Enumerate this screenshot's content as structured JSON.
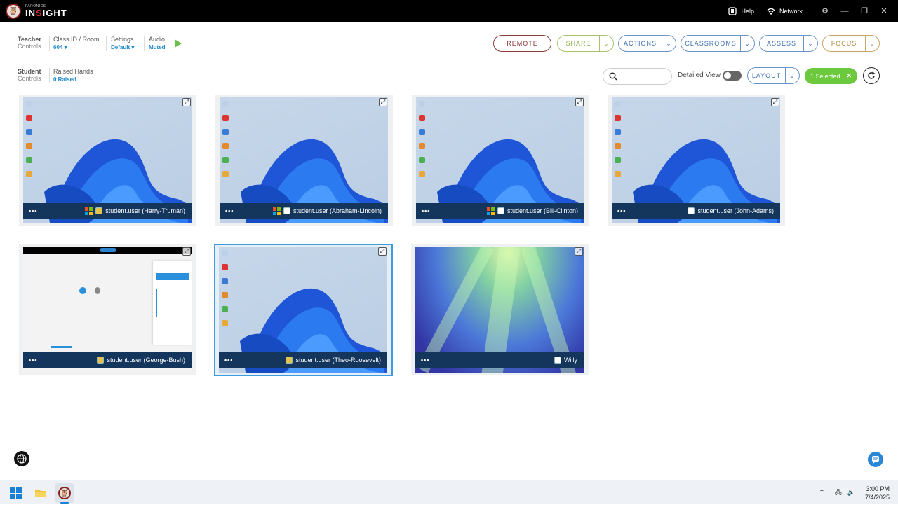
{
  "app": {
    "brand": "FARONICS",
    "name_prefix": "IN",
    "name_red": "S",
    "name_suffix": "IGHT",
    "help": "Help",
    "network": "Network"
  },
  "teacher_controls": {
    "title": "Teacher",
    "subtitle": "Controls",
    "class_label": "Class ID / Room",
    "class_value": "604 ▾",
    "settings_label": "Settings",
    "settings_value": "Default ▾",
    "audio_label": "Audio",
    "audio_value": "Muted"
  },
  "student_controls": {
    "title": "Student",
    "subtitle": "Controls",
    "raised_label": "Raised Hands",
    "raised_value": "0 Raised"
  },
  "toolbar": {
    "remote": "REMOTE",
    "share": "SHARE",
    "actions": "ACTIONS",
    "classrooms": "CLASSROOMS",
    "assess": "ASSESS",
    "focus": "FOCUS",
    "layout": "LAYOUT",
    "detailed_view": "Detailed View",
    "selected": "1 Selected",
    "search_placeholder": ""
  },
  "colors": {
    "remote": "#8b3a3a",
    "share": "#8fae4e",
    "blue": "#3a6fb5",
    "focus": "#b08a3e",
    "selected_green": "#6cc83c",
    "bar": "#14365c"
  },
  "students": [
    {
      "name": "student.user (Harry-Truman)",
      "screen": "win11",
      "icons": [
        "windows-logo",
        "app-icon"
      ]
    },
    {
      "name": "student.user (Abraham-Lincoln)",
      "screen": "win11",
      "icons": [
        "windows-logo",
        "browser-icon"
      ]
    },
    {
      "name": "student.user (Bill-Clinton)",
      "screen": "win11",
      "icons": [
        "windows-logo",
        "browser-icon"
      ]
    },
    {
      "name": "student.user (John-Adams)",
      "screen": "win11",
      "icons": [
        "browser-icon"
      ]
    },
    {
      "name": "student.user (George-Bush)",
      "screen": "insight-app",
      "icons": [
        "app-icon"
      ]
    },
    {
      "name": "student.user (Theo-Roosevelt)",
      "screen": "win11",
      "icons": [
        "app-icon"
      ],
      "selected": true
    },
    {
      "name": "Willy",
      "screen": "aurora",
      "icons": [
        "abc-icon"
      ]
    }
  ],
  "taskbar": {
    "time": "3:00 PM",
    "date": "7/4/2025"
  }
}
